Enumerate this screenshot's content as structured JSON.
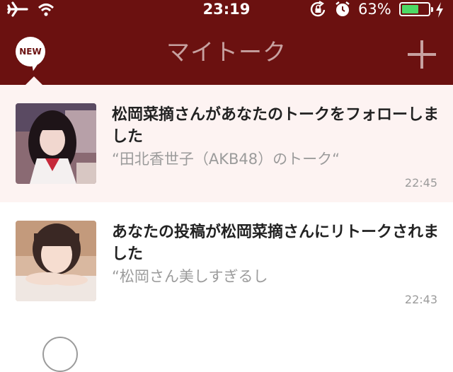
{
  "status_bar": {
    "time": "23:19",
    "battery_percent": "63%",
    "battery_level": 0.63,
    "icons": [
      "airplane-icon",
      "wifi-icon",
      "rotation-lock-icon",
      "alarm-icon",
      "battery-icon",
      "charging-bolt-icon"
    ]
  },
  "nav": {
    "title": "マイトーク",
    "new_badge": "NEW",
    "add_icon": "plus-icon"
  },
  "notifications": [
    {
      "title": "松岡菜摘さんがあなたのトークをフォローしました",
      "quote": "“田北香世子（AKB48）のトーク“",
      "time": "22:45",
      "unread": true
    },
    {
      "title": "あなたの投稿が松岡菜摘さんにリトークされました",
      "quote": "“松岡さん美しすぎるし",
      "time": "22:43",
      "unread": false
    }
  ],
  "colors": {
    "header_bg": "#6b1110",
    "title_text": "#c7a1a0",
    "unread_row_bg": "#fdf3f2",
    "battery_fill": "#4cd964"
  }
}
